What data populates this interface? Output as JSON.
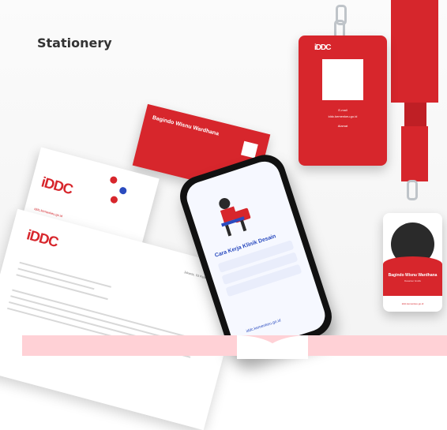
{
  "page": {
    "title": "Stationery"
  },
  "business_card": {
    "name": "Bagindo Wisnu Wardhana",
    "url": "iddc.kemenkeu.go.id"
  },
  "letter": {
    "date": "Jakarta, 03 Februari 2021"
  },
  "phone_screen": {
    "heading": "Cara Kerja Klinik Desain",
    "url": "iddc.kemenkeu.go.id"
  },
  "id_card_back": {
    "label_email": "E-mail",
    "label_address": "Alamat",
    "email": "iddc.kemenkeu.go.id"
  },
  "id_card_front": {
    "name": "Bagindo Wisnu Wardhana",
    "role": "Desainer Grafis",
    "url": "iddc.kemenkeu.go.id"
  },
  "logo_text": "iDDC",
  "colors": {
    "brand_red": "#d7262c",
    "brand_blue": "#2a4bbf",
    "pink_band": "#ffd1d6"
  }
}
